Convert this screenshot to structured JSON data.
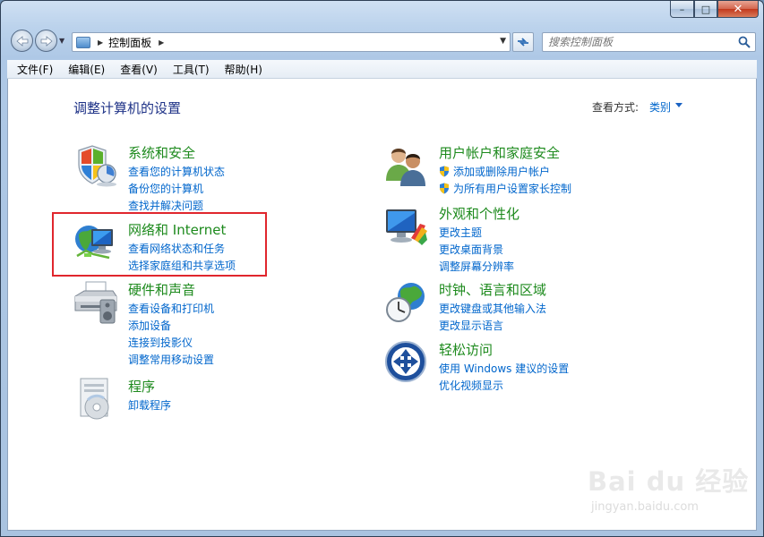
{
  "window": {
    "caption": {
      "minimize": "–",
      "maximize": "□",
      "close": "✕"
    }
  },
  "address": {
    "breadcrumb": "控制面板",
    "search_placeholder": "搜索控制面板"
  },
  "menu": [
    "文件(F)",
    "编辑(E)",
    "查看(V)",
    "工具(T)",
    "帮助(H)"
  ],
  "content": {
    "heading": "调整计算机的设置",
    "view_by_label": "查看方式:",
    "view_by_value": "类别",
    "categories": [
      {
        "title": "系统和安全",
        "icon": "shield-security-icon",
        "links": [
          "查看您的计算机状态",
          "备份您的计算机",
          "查找并解决问题"
        ]
      },
      {
        "title": "网络和 Internet",
        "icon": "globe-network-icon",
        "links": [
          "查看网络状态和任务",
          "选择家庭组和共享选项"
        ]
      },
      {
        "title": "硬件和声音",
        "icon": "printer-speaker-icon",
        "links": [
          "查看设备和打印机",
          "添加设备",
          "连接到投影仪",
          "调整常用移动设置"
        ]
      },
      {
        "title": "程序",
        "icon": "programs-disc-icon",
        "links": [
          "卸载程序"
        ]
      },
      {
        "title": "用户帐户和家庭安全",
        "icon": "users-icon",
        "links": [
          "添加或删除用户帐户",
          "为所有用户设置家长控制"
        ]
      },
      {
        "title": "外观和个性化",
        "icon": "monitor-palette-icon",
        "links": [
          "更改主题",
          "更改桌面背景",
          "调整屏幕分辨率"
        ]
      },
      {
        "title": "时钟、语言和区域",
        "icon": "clock-globe-icon",
        "links": [
          "更改键盘或其他输入法",
          "更改显示语言"
        ]
      },
      {
        "title": "轻松访问",
        "icon": "ease-of-access-icon",
        "links": [
          "使用 Windows 建议的设置",
          "优化视频显示"
        ]
      }
    ]
  },
  "watermark": {
    "brand": "Bai du 经验",
    "url": "jingyan.baidu.com"
  }
}
